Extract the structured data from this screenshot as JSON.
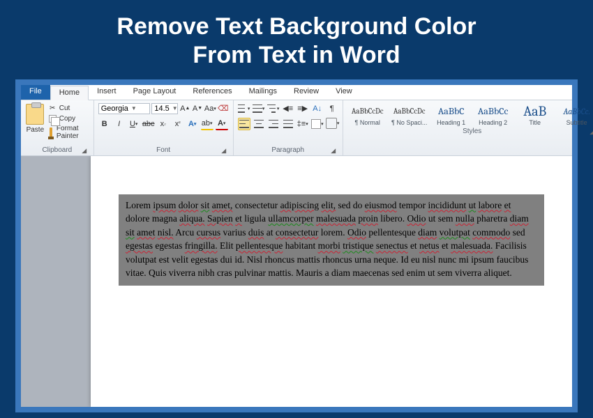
{
  "banner": {
    "line1": "Remove Text Background Color",
    "line2": "From Text in Word"
  },
  "tabs": {
    "file": "File",
    "home": "Home",
    "insert": "Insert",
    "page_layout": "Page Layout",
    "references": "References",
    "mailings": "Mailings",
    "review": "Review",
    "view": "View"
  },
  "clipboard": {
    "paste": "Paste",
    "cut": "Cut",
    "copy": "Copy",
    "format_painter": "Format Painter",
    "label": "Clipboard"
  },
  "font": {
    "name": "Georgia",
    "size": "14.5",
    "label": "Font"
  },
  "paragraph": {
    "label": "Paragraph"
  },
  "styles": {
    "label": "Styles",
    "items": [
      {
        "preview": "AaBbCcDc",
        "name": "¶ Normal",
        "cls": "small"
      },
      {
        "preview": "AaBbCcDc",
        "name": "¶ No Spaci...",
        "cls": "small"
      },
      {
        "preview": "AaBbC",
        "name": "Heading 1",
        "cls": ""
      },
      {
        "preview": "AaBbCc",
        "name": "Heading 2",
        "cls": ""
      },
      {
        "preview": "AaB",
        "name": "Title",
        "cls": "big"
      },
      {
        "preview": "AaBbCc.",
        "name": "Subtitle",
        "cls": "sub"
      }
    ]
  },
  "document": {
    "body": "Lorem ipsum dolor sit amet, consectetur adipiscing elit, sed do eiusmod tempor incididunt ut labore et dolore magna aliqua. Sapien et ligula ullamcorper malesuada proin libero. Odio ut sem nulla pharetra diam sit amet nisl. Arcu cursus varius duis at consectetur lorem. Odio pellentesque diam volutpat commodo sed egestas egestas fringilla. Elit pellentesque habitant morbi tristique senectus et netus et malesuada. Facilisis volutpat est velit egestas dui id. Nisl rhoncus mattis rhoncus urna neque. Id eu nisl nunc mi ipsum faucibus vitae. Quis viverra nibh cras pulvinar mattis. Mauris a diam maecenas sed enim ut sem viverra aliquet."
  }
}
